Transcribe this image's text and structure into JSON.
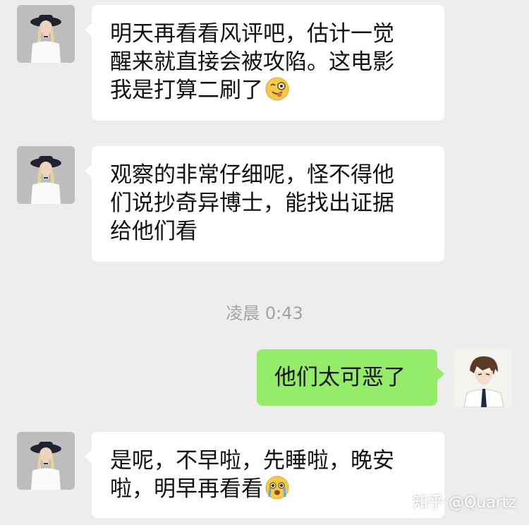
{
  "chat": {
    "messages": [
      {
        "side": "left",
        "lines": [
          "明天再看看风评吧，估计一觉",
          "醒来就直接会被攻陷。这电影",
          "我是打算二刷了"
        ],
        "emoji": "winking-face-with-tongue-icon"
      },
      {
        "side": "left",
        "lines": [
          "观察的非常仔细呢，怪不得他",
          "们说抄奇异博士，能找出证据",
          "给他们看"
        ]
      },
      {
        "side": "right",
        "lines": [
          "他们太可恶了"
        ]
      },
      {
        "side": "left",
        "lines": [
          "是呢，不早啦，先睡啦，晚安",
          "啦，明早再看看"
        ],
        "emoji": "crying-face-icon"
      }
    ],
    "timestamp": "凌晨 0:43"
  },
  "watermark": "知乎 @Quartz",
  "colors": {
    "background": "#ededed",
    "incoming_bubble": "#ffffff",
    "outgoing_bubble": "#95ec69",
    "timestamp_text": "#a3a3a3"
  }
}
